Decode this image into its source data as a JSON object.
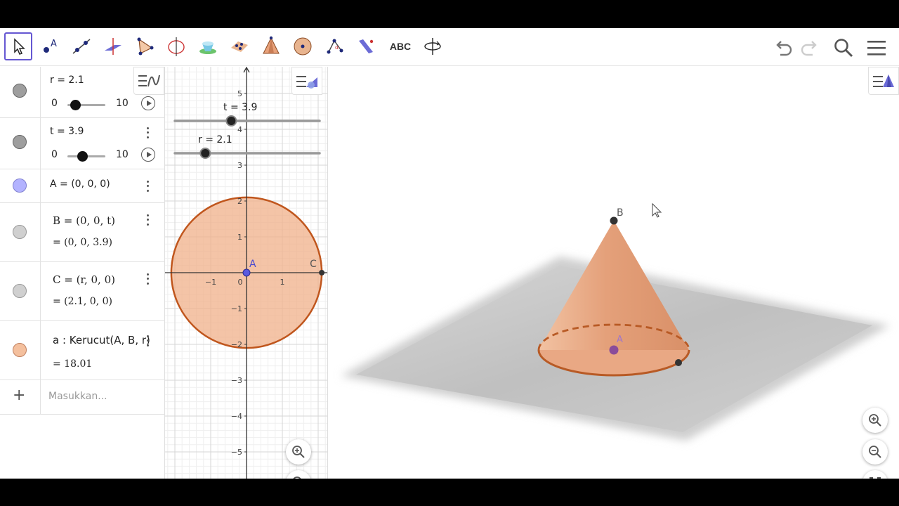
{
  "toolbar": {
    "tools": [
      "move-tool-icon",
      "point-tool-icon",
      "line-tool-icon",
      "perpendicular-tool-icon",
      "polygon-tool-icon",
      "circle-axis-tool-icon",
      "intersect-surfaces-tool-icon",
      "plane-tool-icon",
      "pyramid-tool-icon",
      "sphere-tool-icon",
      "angle-tool-icon",
      "reflect-tool-icon",
      "text-tool-icon",
      "rotate-view-tool-icon"
    ],
    "text_tool_label": "ABC",
    "undo": "undo-icon",
    "redo": "redo-icon",
    "search": "search-icon",
    "menu": "menu-icon"
  },
  "algebra": {
    "r_label": "r = 2.1",
    "r_min": "0",
    "r_max": "10",
    "r_value": 2.1,
    "t_label": "t = 3.9",
    "t_min": "0",
    "t_max": "10",
    "t_value": 3.9,
    "A_def": "A = (0, 0, 0)",
    "B_def": "B  =  (0,  0,  t)",
    "B_val": "=  (0, 0, 3.9)",
    "C_def": "C  =  (r,  0,  0)",
    "C_val": "=  (2.1, 0, 0)",
    "a_def": "a : Kerucut(A, B, r)",
    "a_val": "=  18.01",
    "input_placeholder": "Masukkan...",
    "colors": {
      "gray": "#9e9e9e",
      "point_A": "#b3b3ff",
      "cone": "#f4c09e"
    }
  },
  "graphics": {
    "slider_t_label": "t = 3.9",
    "slider_r_label": "r = 2.1",
    "y_ticks": [
      "5",
      "4",
      "3",
      "2",
      "1",
      "−1",
      "−2",
      "−3",
      "−4",
      "−5"
    ],
    "x_ticks": [
      "−1",
      "0",
      "1"
    ],
    "point_A": "A",
    "point_C": "C",
    "circle_color": "#c0561d",
    "fill_color": "#f0b08a"
  },
  "view3d": {
    "point_B": "B",
    "point_A": "A",
    "cone_color": "#e8a27b"
  }
}
